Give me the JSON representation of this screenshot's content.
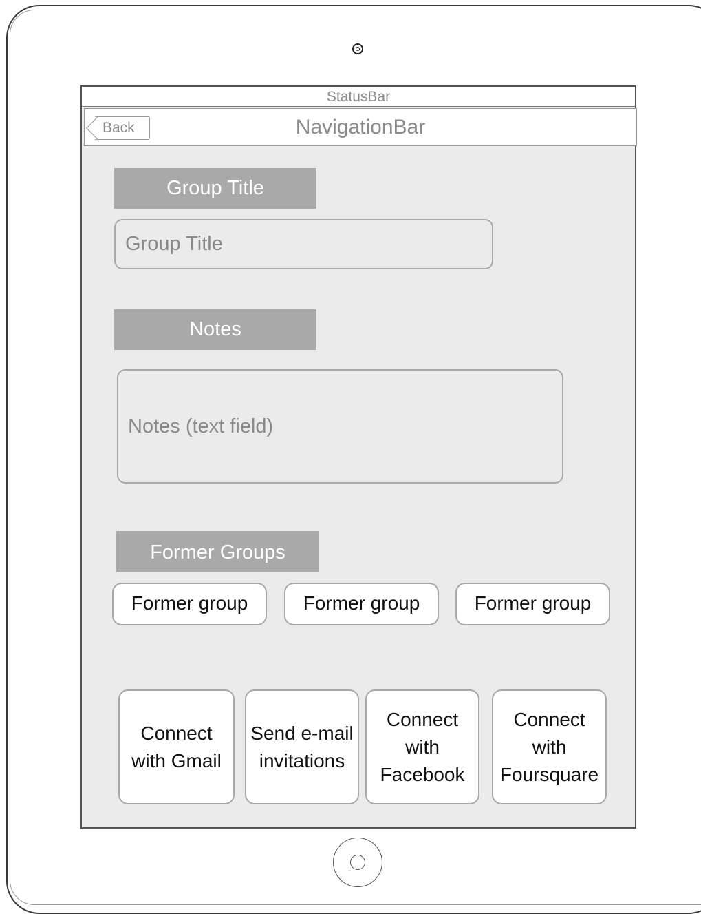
{
  "statusbar": {
    "label": "StatusBar"
  },
  "navbar": {
    "title": "NavigationBar",
    "back_label": "Back"
  },
  "group_title": {
    "section_label": "Group Title",
    "placeholder": "Group Title"
  },
  "notes": {
    "section_label": "Notes",
    "placeholder": "Notes (text field)"
  },
  "former_groups": {
    "section_label": "Former Groups",
    "items": [
      "Former group",
      "Former group",
      "Former group"
    ]
  },
  "connect_buttons": [
    {
      "label": "Connect\nwith Gmail"
    },
    {
      "label": "Send e-mail\ninvitations"
    },
    {
      "label": "Connect\nwith\nFacebook"
    },
    {
      "label": "Connect\nwith\nFoursquare"
    }
  ]
}
